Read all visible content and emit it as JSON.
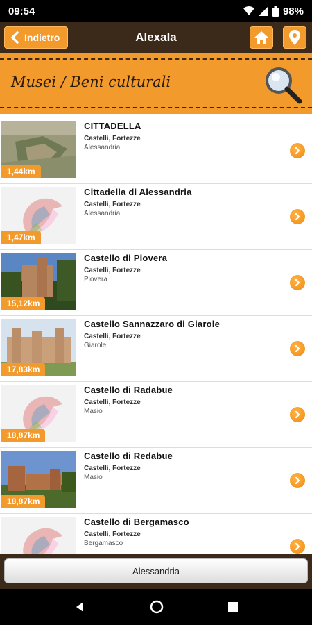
{
  "status_bar": {
    "time": "09:54",
    "battery": "98%"
  },
  "app_bar": {
    "back_label": "Indietro",
    "title": "Alexala",
    "home_icon": "home-icon",
    "map_icon": "map-pin-icon"
  },
  "section": {
    "title": "Musei / Beni culturali",
    "icon": "magnifier-icon"
  },
  "items": [
    {
      "title": "CITTADELLA",
      "category": "Castelli, Fortezze",
      "town": "Alessandria",
      "distance": "1,44km",
      "thumb": "photo"
    },
    {
      "title": "Cittadella di Alessandria",
      "category": "Castelli, Fortezze",
      "town": "Alessandria",
      "distance": "1,47km",
      "thumb": "placeholder"
    },
    {
      "title": "Castello di Piovera",
      "category": "Castelli, Fortezze",
      "town": "Piovera",
      "distance": "15,12km",
      "thumb": "photo"
    },
    {
      "title": "Castello Sannazzaro di Giarole",
      "category": "Castelli, Fortezze",
      "town": "Giarole",
      "distance": "17,83km",
      "thumb": "photo"
    },
    {
      "title": "Castello di Radabue",
      "category": "Castelli, Fortezze",
      "town": "Masio",
      "distance": "18,87km",
      "thumb": "placeholder"
    },
    {
      "title": "Castello di Redabue",
      "category": "Castelli, Fortezze",
      "town": "Masio",
      "distance": "18,87km",
      "thumb": "photo"
    },
    {
      "title": "Castello di Bergamasco",
      "category": "Castelli, Fortezze",
      "town": "Bergamasco",
      "distance": "",
      "thumb": "placeholder"
    }
  ],
  "bottom": {
    "city_label": "Alessandria"
  },
  "colors": {
    "accent": "#f39a2d",
    "bar": "#3b2a1a"
  }
}
